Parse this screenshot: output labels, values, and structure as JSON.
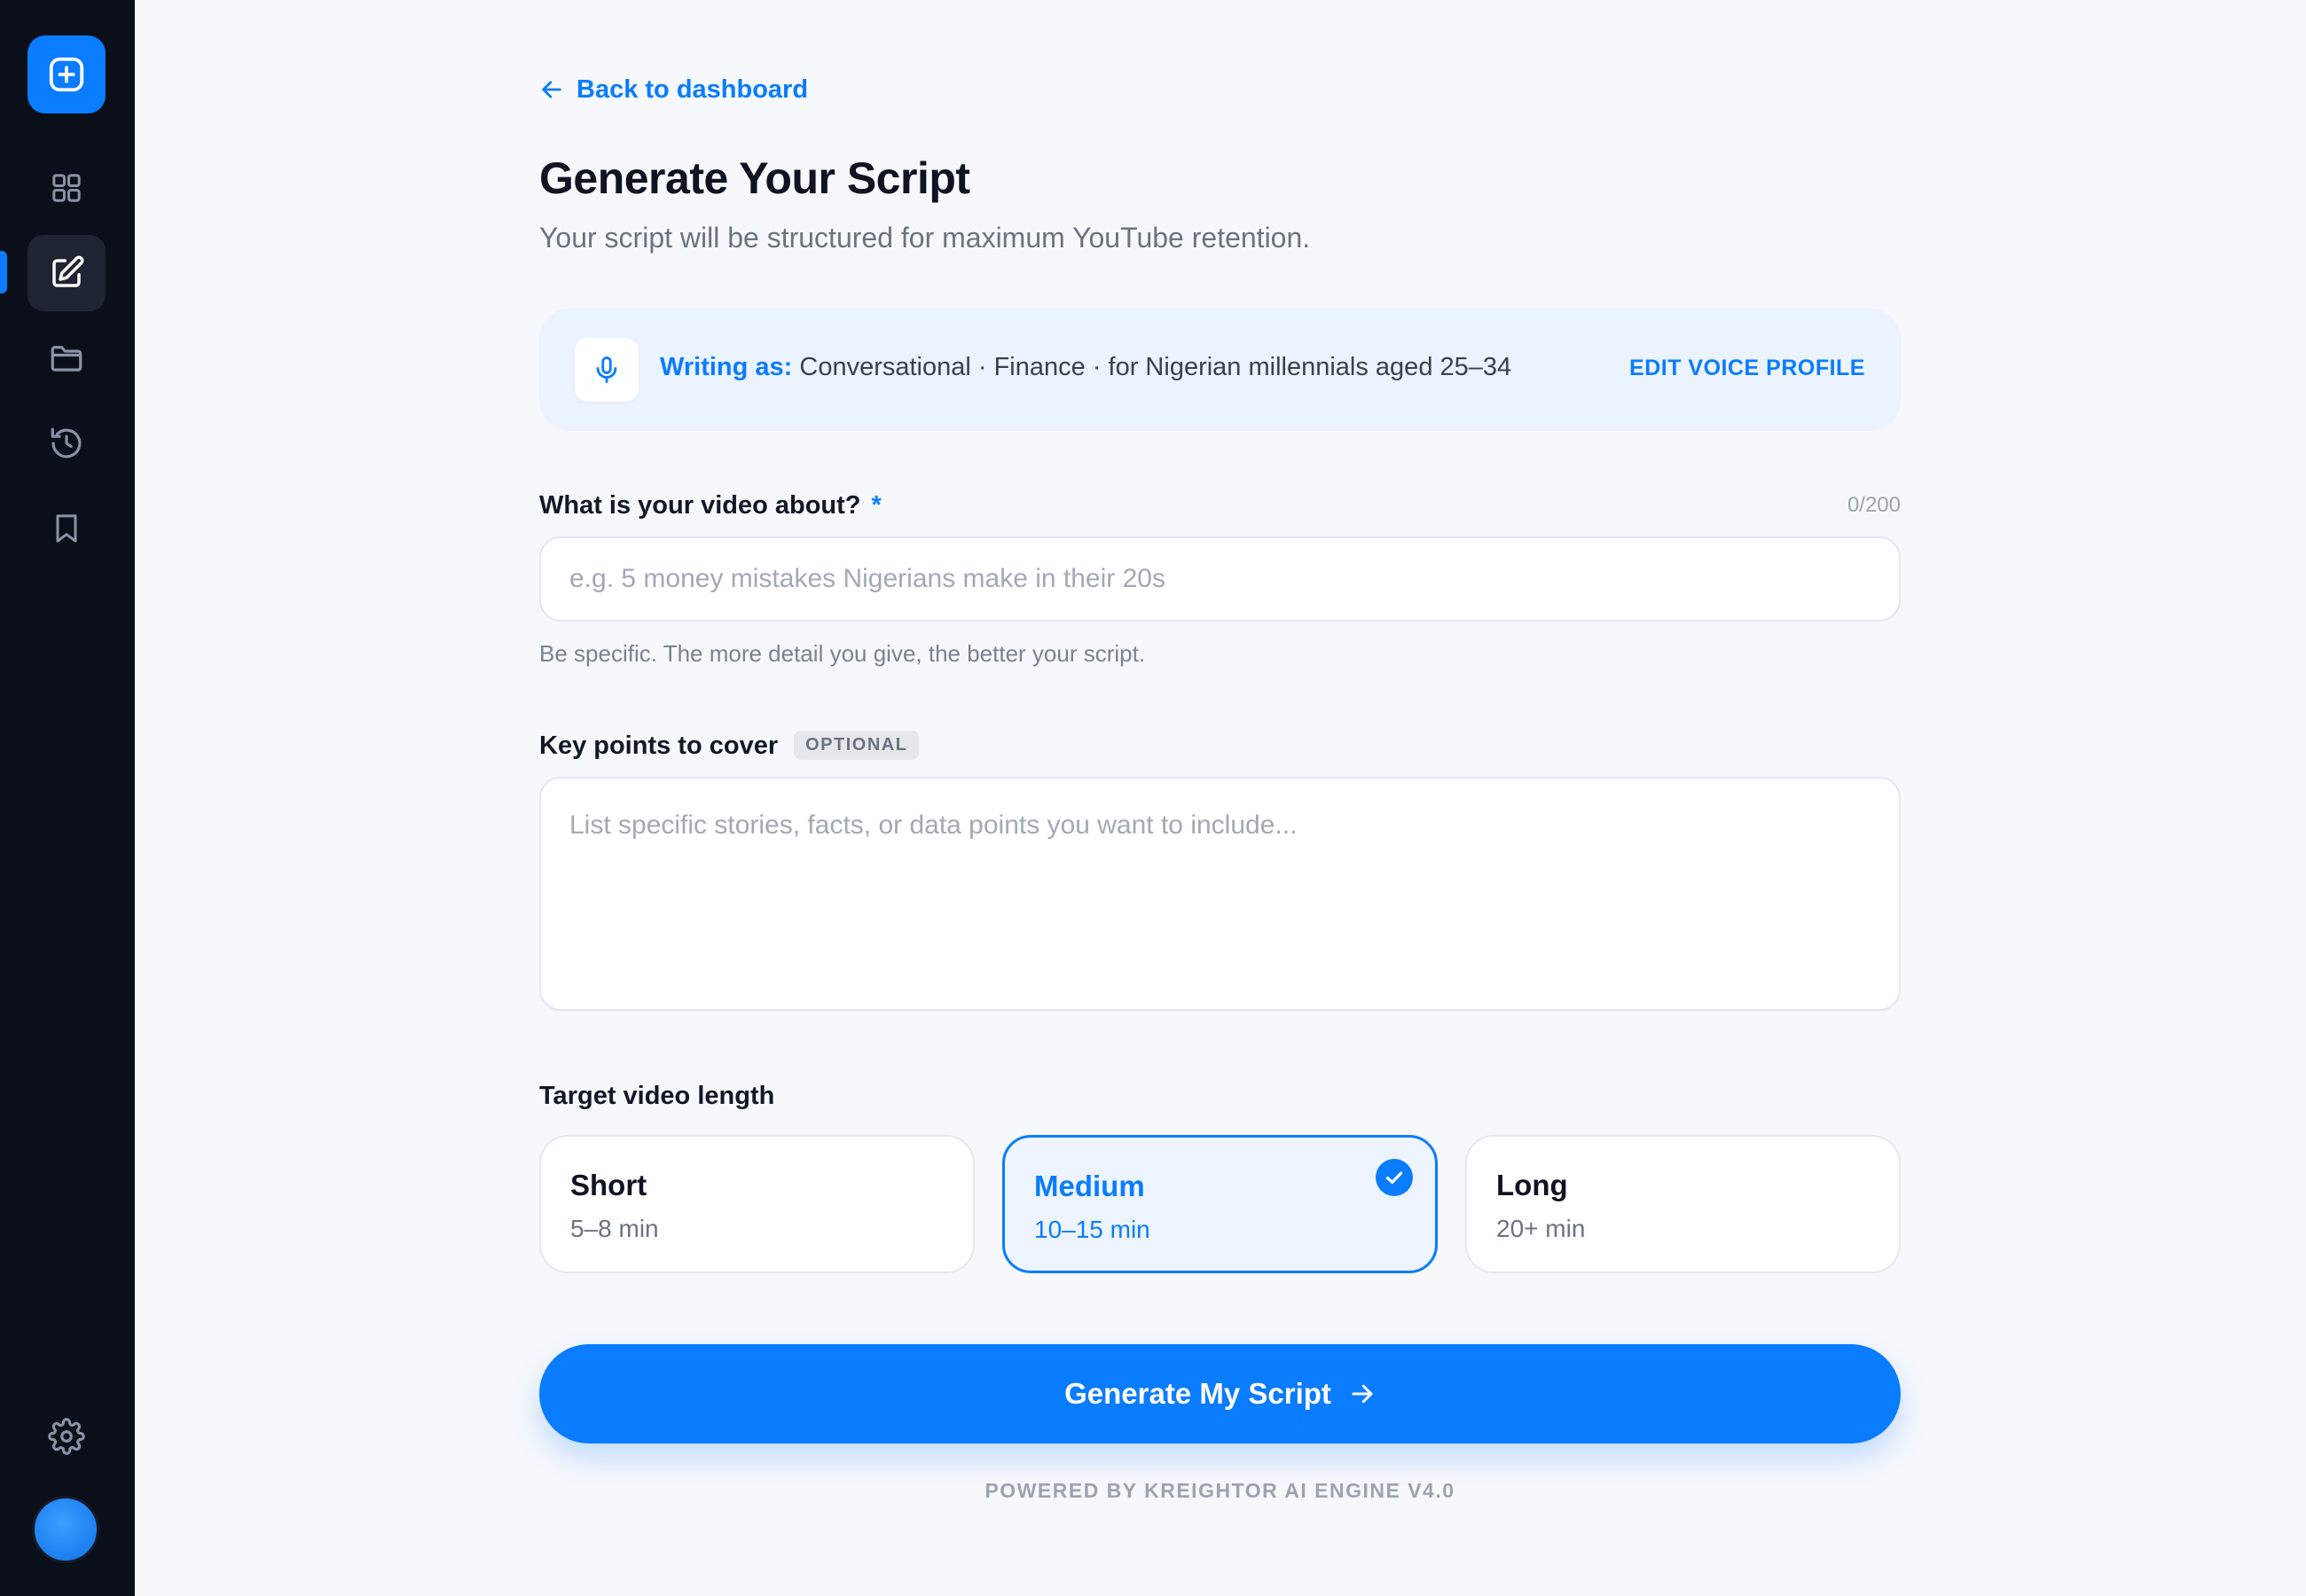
{
  "sidebar": {
    "logo_icon": "plus-square-icon",
    "items": [
      {
        "name": "dashboard",
        "icon": "grid-icon",
        "active": false
      },
      {
        "name": "new-script",
        "icon": "edit-icon",
        "active": true
      },
      {
        "name": "projects",
        "icon": "folder-icon",
        "active": false
      },
      {
        "name": "history",
        "icon": "history-icon",
        "active": false
      },
      {
        "name": "saved",
        "icon": "bookmark-icon",
        "active": false
      }
    ],
    "settings_icon": "gear-icon",
    "avatar_color": "#1d7ff0"
  },
  "header": {
    "back_label": "Back to dashboard",
    "title": "Generate Your Script",
    "subtitle": "Your script will be structured for maximum YouTube retention."
  },
  "voice_profile": {
    "lead": "Writing as:",
    "description": "Conversational · Finance · for Nigerian millennials aged 25–34",
    "edit_label": "EDIT VOICE PROFILE"
  },
  "topic_field": {
    "label": "What is your video about?",
    "required_mark": "*",
    "counter": "0/200",
    "placeholder": "e.g. 5 money mistakes Nigerians make in their 20s",
    "value": "",
    "helper": "Be specific. The more detail you give, the better your script."
  },
  "key_points_field": {
    "label": "Key points to cover",
    "badge": "OPTIONAL",
    "placeholder": "List specific stories, facts, or data points you want to include...",
    "value": ""
  },
  "video_length": {
    "label": "Target video length",
    "options": [
      {
        "name": "Short",
        "range": "5–8 min",
        "selected": false
      },
      {
        "name": "Medium",
        "range": "10–15 min",
        "selected": true
      },
      {
        "name": "Long",
        "range": "20+ min",
        "selected": false
      }
    ]
  },
  "generate_button": {
    "label": "Generate My Script"
  },
  "footer": {
    "powered_by": "POWERED BY KREIGHTOR AI ENGINE V4.0"
  },
  "colors": {
    "accent": "#0a7cff",
    "sidebar_bg": "#0b0f19",
    "page_bg": "#f6f8fc"
  }
}
